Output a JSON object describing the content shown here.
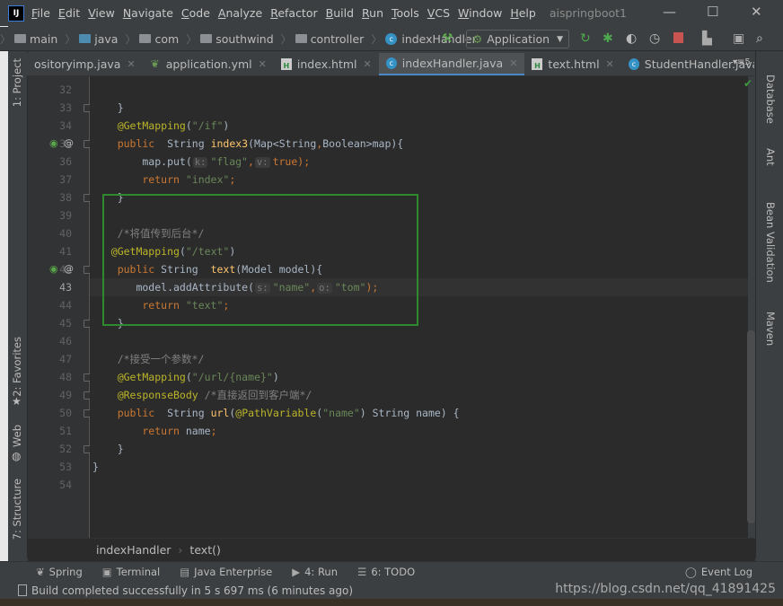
{
  "titlebar": {
    "menus": [
      "File",
      "Edit",
      "View",
      "Navigate",
      "Code",
      "Analyze",
      "Refactor",
      "Build",
      "Run",
      "Tools",
      "VCS",
      "Window",
      "Help"
    ],
    "project": "aispringboot1",
    "minimize": "—",
    "maximize": "☐",
    "close": "✕"
  },
  "navbar": {
    "crumbs": [
      "main",
      "java",
      "com",
      "southwind",
      "controller",
      "indexHandler"
    ],
    "run_config": "Application"
  },
  "tabs": [
    {
      "label": "ositoryimp.java",
      "icon": "java-class-icon"
    },
    {
      "label": "application.yml",
      "icon": "spring-yml-icon"
    },
    {
      "label": "index.html",
      "icon": "html-icon"
    },
    {
      "label": "indexHandler.java",
      "icon": "java-class-icon",
      "active": true
    },
    {
      "label": "text.html",
      "icon": "html-icon"
    },
    {
      "label": "StudentHandler.java",
      "icon": "java-class-icon"
    }
  ],
  "tab_overflow": "▾≡5",
  "left_tools": [
    "1: Project",
    "2: Favorites",
    "Web",
    "7: Structure"
  ],
  "right_tools": [
    "Database",
    "Ant",
    "Bean Validation",
    "Maven"
  ],
  "code": [
    {
      "n": 32,
      "tokens": []
    },
    {
      "n": 33,
      "tokens": [
        {
          "t": "    }",
          "c": ""
        }
      ],
      "fold": true
    },
    {
      "n": 34,
      "tokens": [
        {
          "t": "    @GetMapping",
          "c": "ann"
        },
        {
          "t": "(",
          "c": ""
        },
        {
          "t": "\"/if\"",
          "c": "str"
        },
        {
          "t": ")",
          "c": ""
        }
      ]
    },
    {
      "n": 35,
      "tokens": [
        {
          "t": "    public  ",
          "c": "kw"
        },
        {
          "t": "String ",
          "c": ""
        },
        {
          "t": "index3",
          "c": "fn"
        },
        {
          "t": "(Map<String",
          "c": ""
        },
        {
          "t": ",",
          "c": "kw"
        },
        {
          "t": "Boolean>map){",
          "c": ""
        }
      ],
      "gutter": true,
      "fold": true
    },
    {
      "n": 36,
      "tokens": [
        {
          "t": "        map.put(",
          "c": ""
        },
        {
          "t": "k:",
          "c": "hint"
        },
        {
          "t": "\"flag\"",
          "c": "str"
        },
        {
          "t": ",",
          "c": "kw"
        },
        {
          "t": "v:",
          "c": "hint"
        },
        {
          "t": "true",
          "c": "kw"
        },
        {
          "t": ");",
          "c": "kw"
        }
      ]
    },
    {
      "n": 37,
      "tokens": [
        {
          "t": "        return ",
          "c": "kw"
        },
        {
          "t": "\"index\"",
          "c": "str"
        },
        {
          "t": ";",
          "c": "kw"
        }
      ]
    },
    {
      "n": 38,
      "tokens": [
        {
          "t": "    }",
          "c": ""
        }
      ],
      "fold": true
    },
    {
      "n": 39,
      "tokens": []
    },
    {
      "n": 40,
      "tokens": [
        {
          "t": "    /*将值传到后台*/",
          "c": "cm"
        }
      ]
    },
    {
      "n": 41,
      "tokens": [
        {
          "t": "   @GetMapping",
          "c": "ann"
        },
        {
          "t": "(",
          "c": ""
        },
        {
          "t": "\"/text\"",
          "c": "str"
        },
        {
          "t": ")",
          "c": ""
        }
      ]
    },
    {
      "n": 42,
      "tokens": [
        {
          "t": "    public ",
          "c": "kw"
        },
        {
          "t": "String  ",
          "c": ""
        },
        {
          "t": "text",
          "c": "fn"
        },
        {
          "t": "(Model model){",
          "c": ""
        }
      ],
      "gutter": true,
      "fold": true
    },
    {
      "n": 43,
      "tokens": [
        {
          "t": "       model.addAttribute(",
          "c": ""
        },
        {
          "t": "s:",
          "c": "hint"
        },
        {
          "t": "\"name\"",
          "c": "str"
        },
        {
          "t": ",",
          "c": "kw"
        },
        {
          "t": "o:",
          "c": "hint"
        },
        {
          "t": "\"tom\"",
          "c": "str"
        },
        {
          "t": ");",
          "c": "kw"
        }
      ],
      "current": true
    },
    {
      "n": 44,
      "tokens": [
        {
          "t": "        return ",
          "c": "kw"
        },
        {
          "t": "\"text\"",
          "c": "str"
        },
        {
          "t": ";",
          "c": "kw"
        }
      ]
    },
    {
      "n": 45,
      "tokens": [
        {
          "t": "    }",
          "c": ""
        }
      ],
      "fold": true
    },
    {
      "n": 46,
      "tokens": []
    },
    {
      "n": 47,
      "tokens": [
        {
          "t": "    /*接受一个参数*/",
          "c": "cm"
        }
      ]
    },
    {
      "n": 48,
      "tokens": [
        {
          "t": "    @GetMapping",
          "c": "ann"
        },
        {
          "t": "(",
          "c": ""
        },
        {
          "t": "\"/url/{name}\"",
          "c": "str"
        },
        {
          "t": ")",
          "c": ""
        }
      ],
      "fold": true
    },
    {
      "n": 49,
      "tokens": [
        {
          "t": "    @ResponseBody ",
          "c": "ann"
        },
        {
          "t": "/*直接返回到客户端*/",
          "c": "cm"
        }
      ],
      "fold": true
    },
    {
      "n": 50,
      "tokens": [
        {
          "t": "    public  ",
          "c": "kw"
        },
        {
          "t": "String ",
          "c": ""
        },
        {
          "t": "url",
          "c": "fn"
        },
        {
          "t": "(",
          "c": ""
        },
        {
          "t": "@PathVariable",
          "c": "ann"
        },
        {
          "t": "(",
          "c": ""
        },
        {
          "t": "\"name\"",
          "c": "str"
        },
        {
          "t": ") String name) {",
          "c": ""
        }
      ],
      "fold": true
    },
    {
      "n": 51,
      "tokens": [
        {
          "t": "        return ",
          "c": "kw"
        },
        {
          "t": "name",
          "c": ""
        },
        {
          "t": ";",
          "c": "kw"
        }
      ]
    },
    {
      "n": 52,
      "tokens": [
        {
          "t": "    }",
          "c": ""
        }
      ],
      "fold": true
    },
    {
      "n": 53,
      "tokens": [
        {
          "t": "}",
          "c": ""
        }
      ]
    },
    {
      "n": 54,
      "tokens": []
    }
  ],
  "breadcrumb": {
    "class": "indexHandler",
    "method": "text()"
  },
  "toolwindows": [
    {
      "label": "Spring",
      "icon": "❦"
    },
    {
      "label": "Terminal",
      "icon": "▣"
    },
    {
      "label": "Java Enterprise",
      "icon": "▤"
    },
    {
      "label": "4: Run",
      "icon": "▶"
    },
    {
      "label": "6: TODO",
      "icon": "☰"
    }
  ],
  "event_log": "Event Log",
  "status": "Build completed successfully in 5 s 697 ms (6 minutes ago)",
  "watermark": "https://blog.csdn.net/qq_41891425",
  "colors": {
    "highlight_box": "#2f8a2f",
    "accent": "#4a88c7"
  }
}
